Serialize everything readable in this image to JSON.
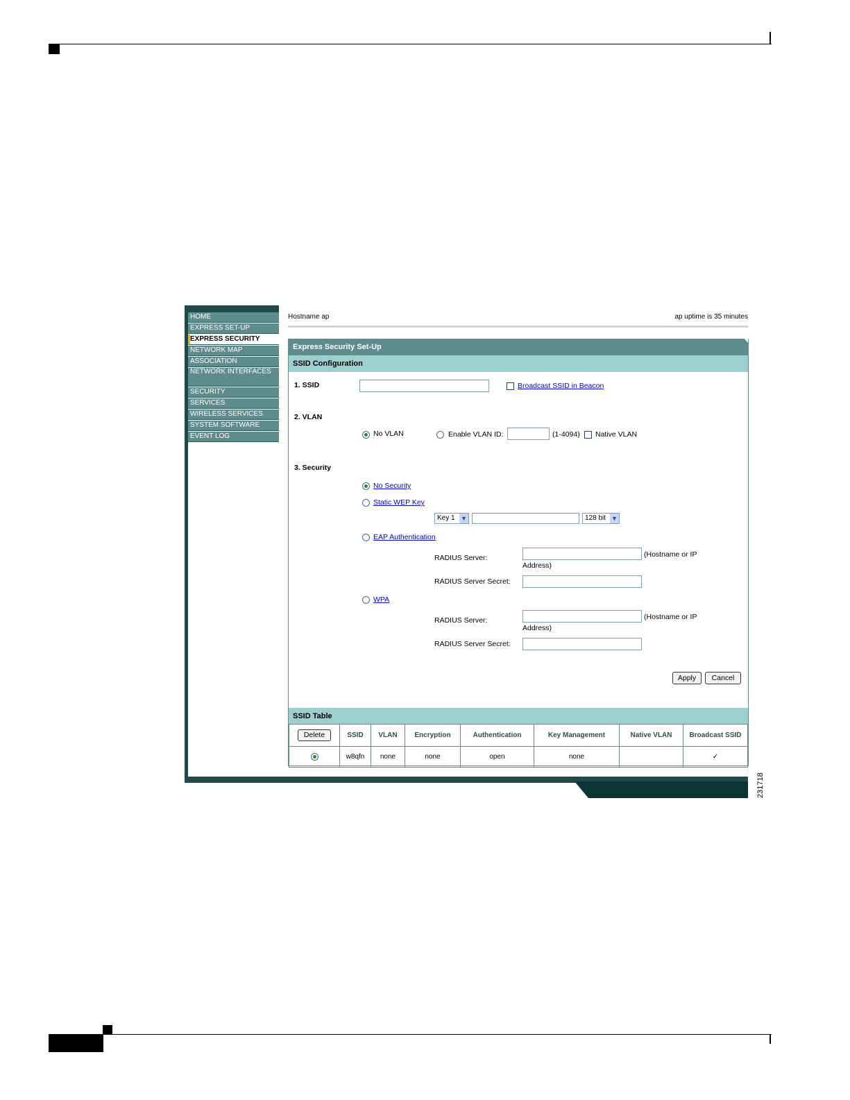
{
  "figure_id": "231718",
  "nav": {
    "items": [
      "HOME",
      "EXPRESS SET-UP",
      "EXPRESS SECURITY",
      "NETWORK MAP",
      "ASSOCIATION",
      "NETWORK INTERFACES",
      "SECURITY",
      "SERVICES",
      "WIRELESS SERVICES",
      "SYSTEM SOFTWARE",
      "EVENT LOG"
    ],
    "active": "EXPRESS SECURITY"
  },
  "header": {
    "hostname": "Hostname  ap",
    "uptime": "ap uptime is 35 minutes"
  },
  "panel": {
    "title": "Express Security Set-Up",
    "ssid_config_title": "SSID Configuration",
    "ssid_label": "1. SSID",
    "ssid_value": "",
    "broadcast_label": "Broadcast SSID in Beacon",
    "vlan_label": "2. VLAN",
    "no_vlan_label": "No VLAN",
    "enable_vlan_label": "Enable VLAN ID:",
    "vlan_range": "(1-4094)",
    "native_vlan_label": "Native VLAN",
    "security_label": "3. Security",
    "no_security_label": "No Security",
    "static_wep_label": "Static WEP Key",
    "key_select": "Key 1",
    "bit_select": "128 bit",
    "eap_label": "EAP Authentication",
    "radius_server_label": "RADIUS Server:",
    "radius_hint_line1": "(Hostname or IP",
    "radius_hint_line2": "Address)",
    "radius_secret_label": "RADIUS Server Secret:",
    "wpa_label": "WPA",
    "apply_label": "Apply",
    "cancel_label": "Cancel"
  },
  "ssid_table": {
    "title": "SSID Table",
    "delete_label": "Delete",
    "headers": [
      "SSID",
      "VLAN",
      "Encryption",
      "Authentication",
      "Key Management",
      "Native VLAN",
      "Broadcast SSID"
    ],
    "rows": [
      {
        "ssid": "w8qfn",
        "vlan": "none",
        "encryption": "none",
        "authentication": "open",
        "key_management": "none",
        "native_vlan": "",
        "broadcast": "✓"
      }
    ]
  }
}
